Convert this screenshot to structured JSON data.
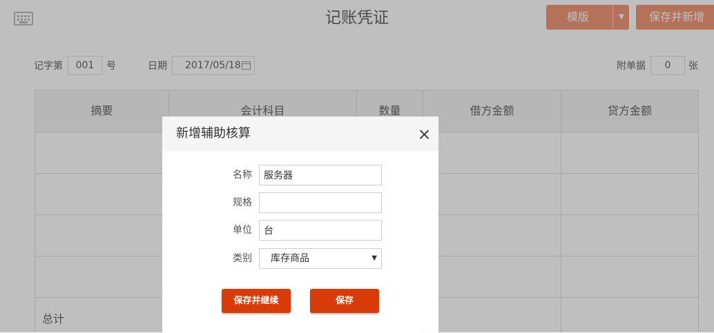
{
  "header": {
    "title": "记账凭证",
    "template_label": "模版",
    "save_new_label": "保存并新增",
    "keyboard_icon": "keyboard-icon"
  },
  "meta": {
    "voucher_prefix": "记字第",
    "voucher_no": "001",
    "voucher_suffix": "号",
    "date_label": "日期",
    "date_value": "2017/05/18",
    "attach_label": "附单据",
    "attach_count": "0",
    "attach_suffix": "张"
  },
  "table": {
    "columns": [
      "摘要",
      "会计科目",
      "数量",
      "借方金额",
      "贷方金额"
    ],
    "total_label": "总计"
  },
  "dialog": {
    "title": "新增辅助核算",
    "fields": {
      "name": {
        "label": "名称",
        "value": "服务器"
      },
      "spec": {
        "label": "规格",
        "value": ""
      },
      "unit": {
        "label": "单位",
        "value": "台"
      },
      "category": {
        "label": "类别",
        "value": "库存商品"
      }
    },
    "save_continue_label": "保存并继续",
    "save_label": "保存"
  },
  "colors": {
    "primary": "#d83b08",
    "primary_faded": "#f0997a",
    "overlay": "rgba(0,0,0,0.25)"
  }
}
